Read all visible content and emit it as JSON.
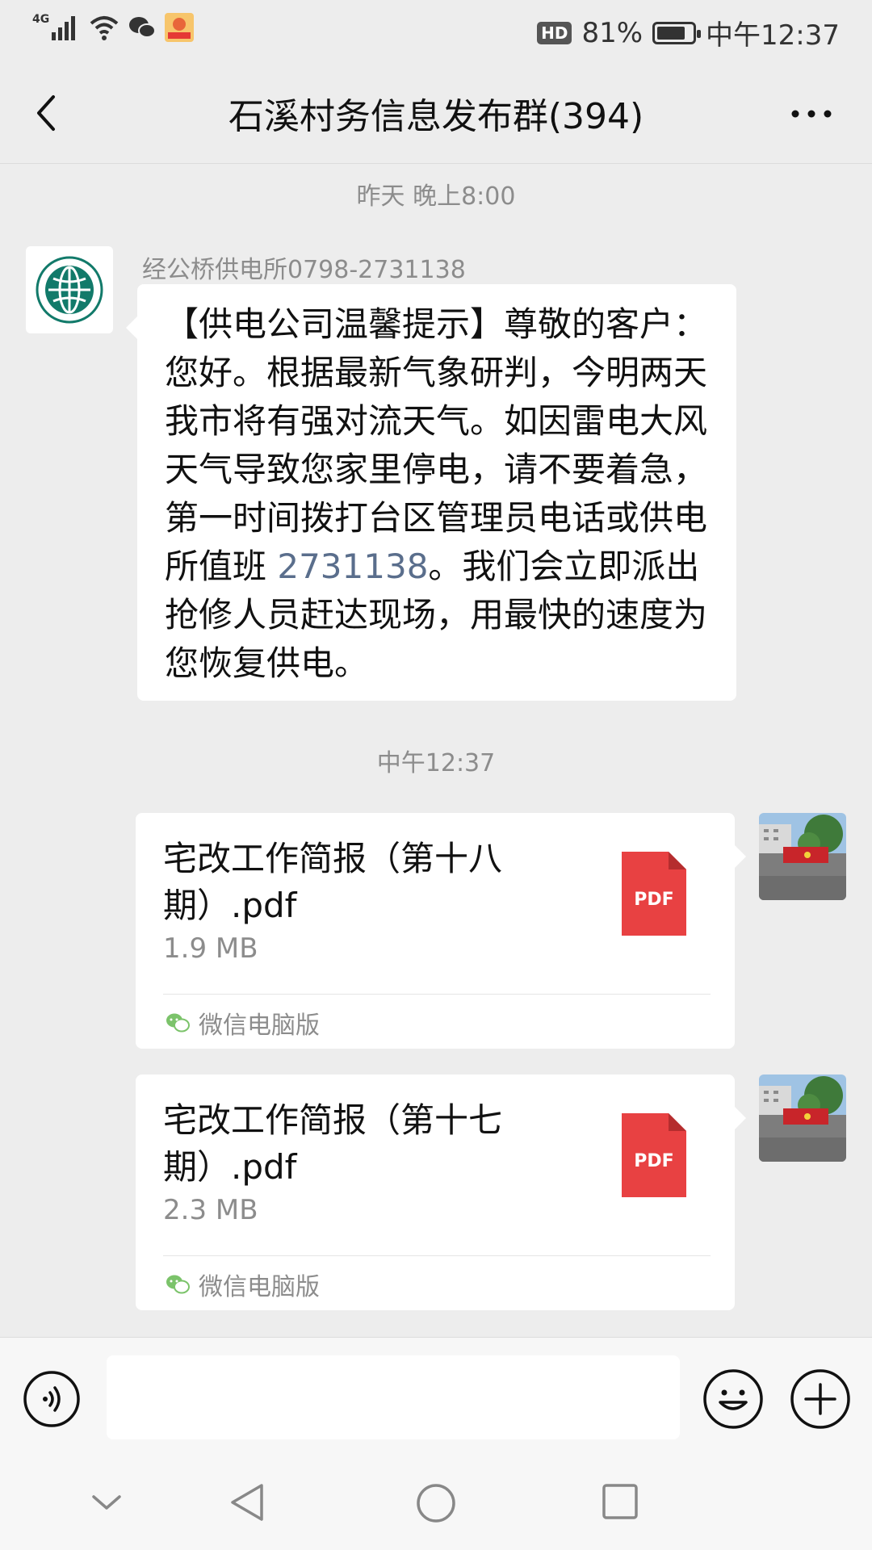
{
  "status_bar": {
    "network": "4G",
    "hd": "HD",
    "battery_text": "81%",
    "battery_level": 0.81,
    "time": "中午12:37"
  },
  "header": {
    "title": "石溪村务信息发布群(394)"
  },
  "messages": {
    "time1": "昨天 晚上8:00",
    "sender_name": "经公桥供电所0798-2731138",
    "text_part1": "【供电公司温馨提示】尊敬的客户： 您好。根据最新气象研判，今明两天我市将有强对流天气。如因雷电大风天气导致您家里停电，请不要着急，第一时间拨打台区管理员电话或供电所值班 ",
    "phone": "2731138",
    "text_part2": "。我们会立即派出抢修人员赶达现场，用最快的速度为您恢复供电。",
    "time2": "中午12:37",
    "files": [
      {
        "name": "宅改工作简报（第十八期）.pdf",
        "size": "1.9 MB",
        "icon_label": "PDF",
        "source": "微信电脑版"
      },
      {
        "name": "宅改工作简报（第十七期）.pdf",
        "size": "2.3 MB",
        "icon_label": "PDF",
        "source": "微信电脑版"
      }
    ]
  },
  "colors": {
    "pdf_red": "#e84142",
    "wechat_green": "#7bc36a",
    "link_blue": "#5a6e8c"
  }
}
